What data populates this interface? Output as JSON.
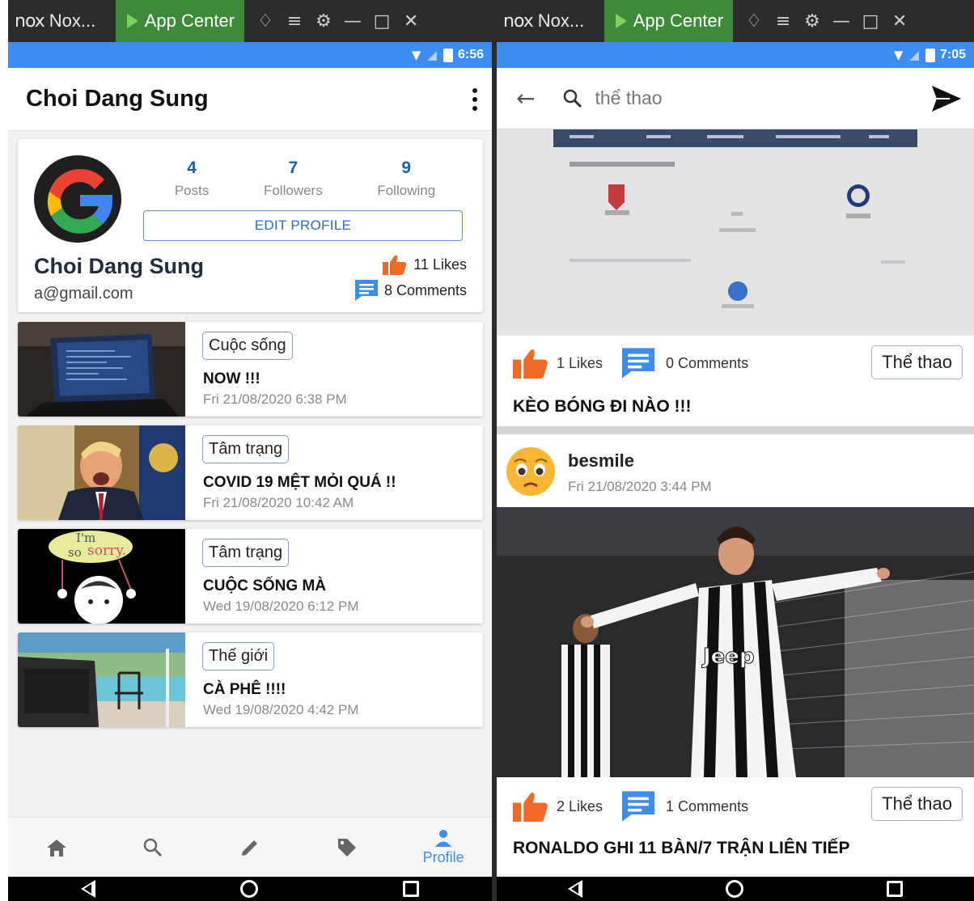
{
  "left": {
    "titlebar": {
      "logo": "nox",
      "name": "Nox...",
      "app_center": "App Center"
    },
    "status": {
      "time": "6:56"
    },
    "appbar": {
      "title": "Choi Dang Sung"
    },
    "profile": {
      "posts_count": "4",
      "posts_label": "Posts",
      "followers_count": "7",
      "followers_label": "Followers",
      "following_count": "9",
      "following_label": "Following",
      "edit_label": "EDIT PROFILE",
      "name": "Choi Dang Sung",
      "email": "a@gmail.com",
      "likes": "11 Likes",
      "comments": "8 Comments"
    },
    "posts": [
      {
        "category": "Cuộc sống",
        "title": "NOW !!!",
        "date": "Fri 21/08/2020 6:38 PM"
      },
      {
        "category": "Tâm trạng",
        "title": "COVID 19 MỆT MỎI QUÁ !!",
        "date": "Fri 21/08/2020 10:42 AM"
      },
      {
        "category": "Tâm trạng",
        "title": "CUỘC SỐNG MÀ",
        "date": "Wed 19/08/2020 6:12 PM",
        "thumb_text_1": "I'm",
        "thumb_text_2": "so",
        "thumb_text_3": "sorry."
      },
      {
        "category": "Thế giới",
        "title": "CÀ PHÊ !!!!",
        "date": "Wed 19/08/2020 4:42 PM"
      }
    ],
    "tabbar": {
      "profile_label": "Profile"
    }
  },
  "right": {
    "titlebar": {
      "logo": "nox",
      "name": "Nox...",
      "app_center": "App Center"
    },
    "status": {
      "time": "7:05"
    },
    "search": {
      "value": "thể thao"
    },
    "feed": [
      {
        "likes": "1 Likes",
        "comments": "0 Comments",
        "tag": "Thể thao",
        "title": "KÈO BÓNG ĐI NÀO !!!"
      },
      {
        "author": "besmile",
        "date": "Fri 21/08/2020 3:44 PM",
        "likes": "2 Likes",
        "comments": "1 Comments",
        "tag": "Thể thao",
        "title": "RONALDO GHI 11 BÀN/7 TRẬN LIÊN TIẾP",
        "jersey_text": "Jeep"
      }
    ]
  },
  "colors": {
    "accent": "#3d8cf0",
    "like_orange": "#f06a26",
    "comment_blue": "#3d8cf0",
    "appcenter_green": "#3f8a3a"
  }
}
